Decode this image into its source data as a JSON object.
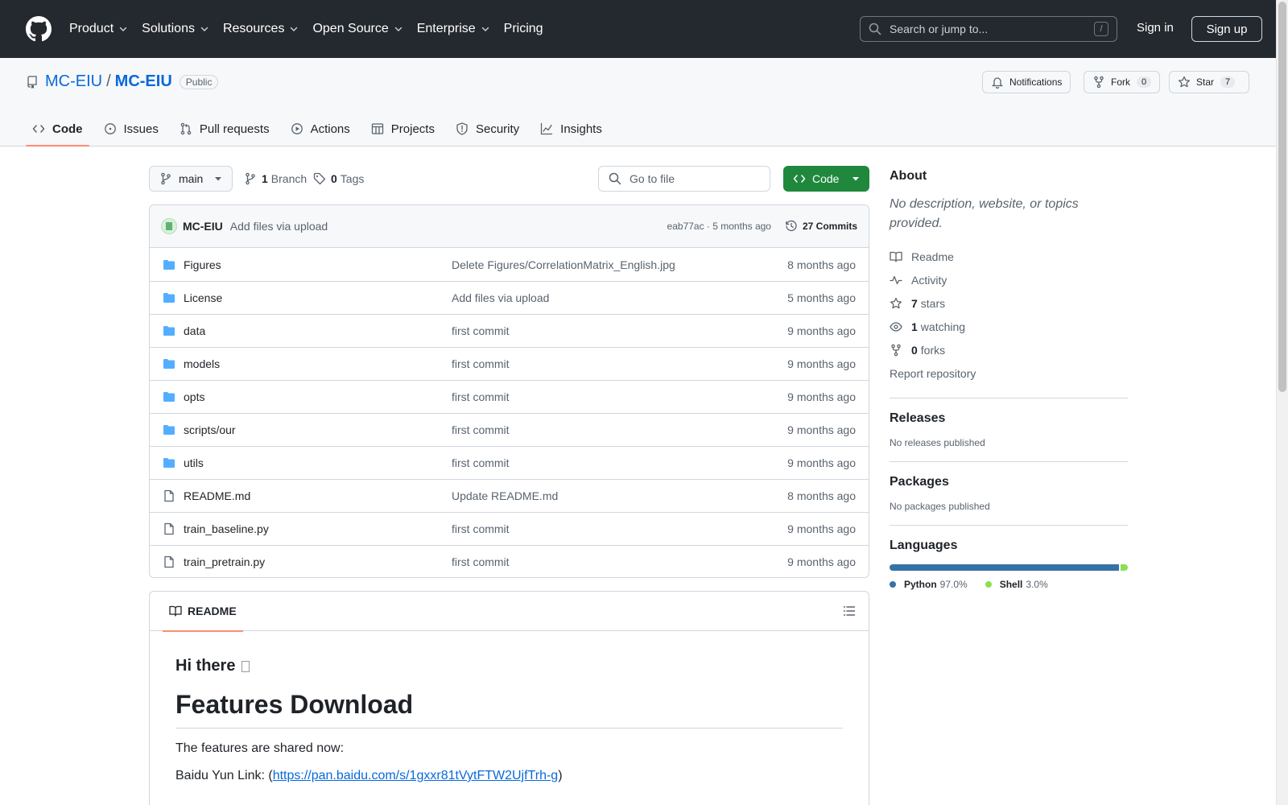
{
  "header": {
    "nav": [
      "Product",
      "Solutions",
      "Resources",
      "Open Source",
      "Enterprise",
      "Pricing"
    ],
    "search_placeholder": "Search or jump to...",
    "search_shortcut": "/",
    "sign_in": "Sign in",
    "sign_up": "Sign up"
  },
  "repo": {
    "owner": "MC-EIU",
    "separator": "/",
    "name": "MC-EIU",
    "visibility": "Public",
    "notifications_label": "Notifications",
    "fork_label": "Fork",
    "fork_count": "0",
    "star_label": "Star",
    "star_count": "7"
  },
  "tabs": [
    "Code",
    "Issues",
    "Pull requests",
    "Actions",
    "Projects",
    "Security",
    "Insights"
  ],
  "toolbar": {
    "branch": "main",
    "branch_count": "1",
    "branch_label": "Branch",
    "tag_count": "0",
    "tag_label": "Tags",
    "goto_placeholder": "Go to file",
    "code_label": "Code"
  },
  "commit": {
    "author": "MC-EIU",
    "message": "Add files via upload",
    "hash_time": "eab77ac · 5 months ago",
    "commits_label": "27 Commits"
  },
  "files": [
    {
      "name": "Figures",
      "type": "dir",
      "message": "Delete Figures/CorrelationMatrix_English.jpg",
      "date": "8 months ago"
    },
    {
      "name": "License",
      "type": "dir",
      "message": "Add files via upload",
      "date": "5 months ago"
    },
    {
      "name": "data",
      "type": "dir",
      "message": "first commit",
      "date": "9 months ago"
    },
    {
      "name": "models",
      "type": "dir",
      "message": "first commit",
      "date": "9 months ago"
    },
    {
      "name": "opts",
      "type": "dir",
      "message": "first commit",
      "date": "9 months ago"
    },
    {
      "name": "scripts/our",
      "type": "dir",
      "message": "first commit",
      "date": "9 months ago"
    },
    {
      "name": "utils",
      "type": "dir",
      "message": "first commit",
      "date": "9 months ago"
    },
    {
      "name": "README.md",
      "type": "file",
      "message": "Update README.md",
      "date": "8 months ago"
    },
    {
      "name": "train_baseline.py",
      "type": "file",
      "message": "first commit",
      "date": "9 months ago"
    },
    {
      "name": "train_pretrain.py",
      "type": "file",
      "message": "first commit",
      "date": "9 months ago"
    }
  ],
  "readme": {
    "tab_label": "README",
    "greeting": "Hi there",
    "heading": "Features Download",
    "paragraph": "The features are shared now:",
    "link_prefix": "Baidu Yun Link: (",
    "link_text": "https://pan.baidu.com/s/1gxxr81tVytFTW2UjfTrh-g",
    "link_suffix": ")"
  },
  "sidebar": {
    "about_title": "About",
    "about_desc": "No description, website, or topics provided.",
    "readme_label": "Readme",
    "activity_label": "Activity",
    "stars_count": "7",
    "stars_label": "stars",
    "watching_count": "1",
    "watching_label": "watching",
    "forks_count": "0",
    "forks_label": "forks",
    "report_label": "Report repository",
    "releases_title": "Releases",
    "releases_text": "No releases published",
    "packages_title": "Packages",
    "packages_text": "No packages published",
    "languages_title": "Languages",
    "languages": [
      {
        "name": "Python",
        "percent": "97.0%",
        "value": 97.0,
        "color": "#3572A5"
      },
      {
        "name": "Shell",
        "percent": "3.0%",
        "value": 3.0,
        "color": "#89e051"
      }
    ]
  }
}
